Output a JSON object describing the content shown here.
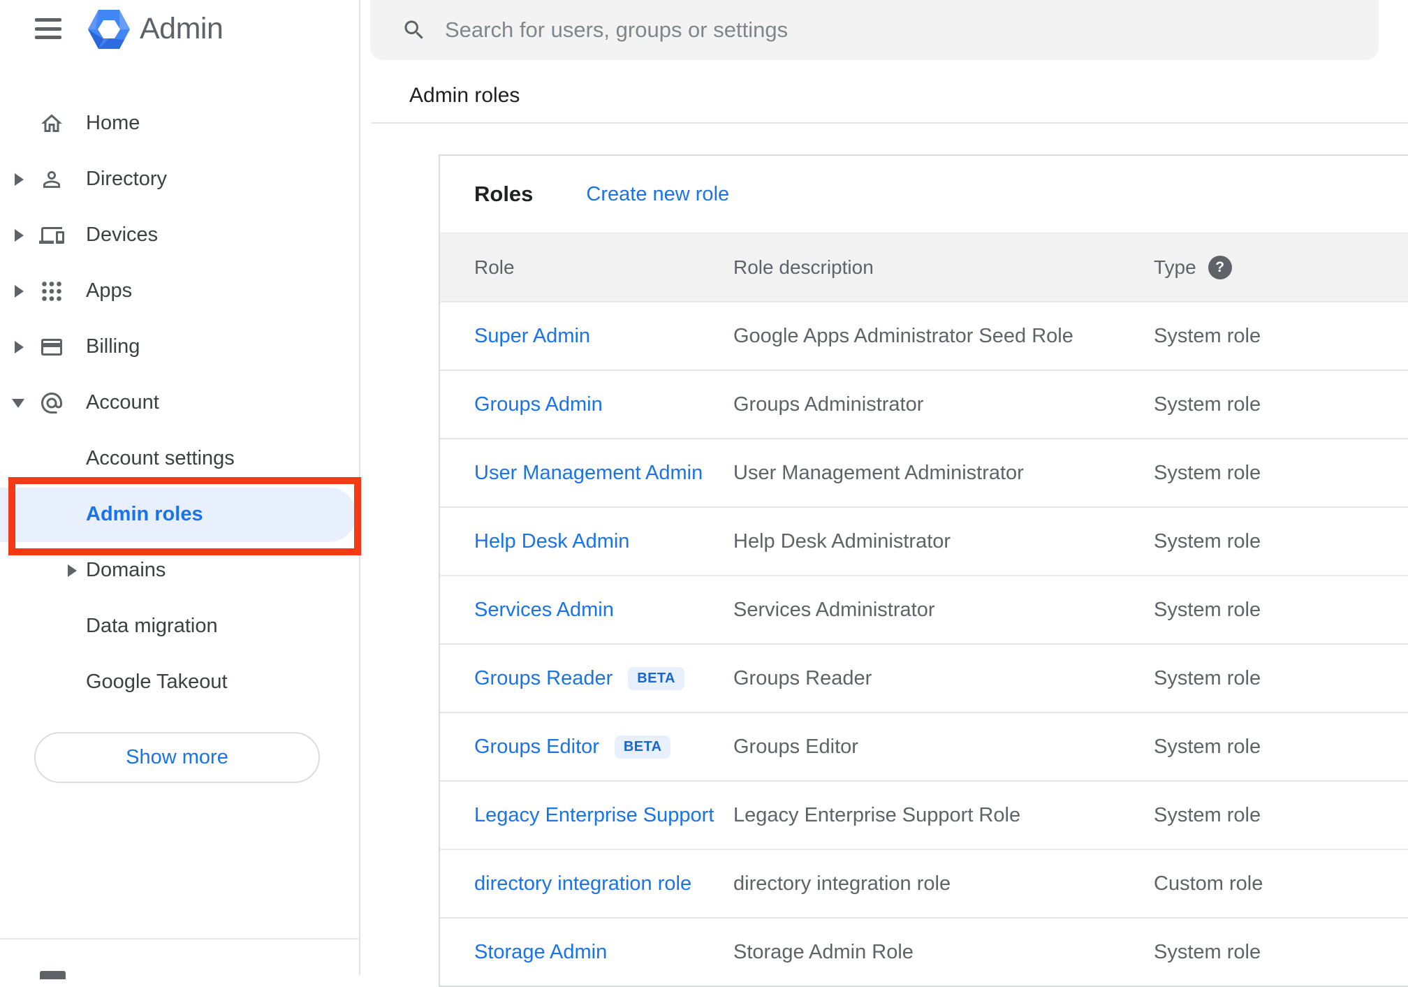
{
  "app": {
    "title": "Admin"
  },
  "topbar": {
    "search_placeholder": "Search for users, groups or settings"
  },
  "breadcrumb": {
    "label": "Admin roles"
  },
  "sidebar": {
    "items": [
      {
        "label": "Home",
        "icon": "home-icon",
        "expandable": false
      },
      {
        "label": "Directory",
        "icon": "person-icon",
        "expandable": true
      },
      {
        "label": "Devices",
        "icon": "devices-icon",
        "expandable": true
      },
      {
        "label": "Apps",
        "icon": "apps-grid-icon",
        "expandable": true
      },
      {
        "label": "Billing",
        "icon": "credit-card-icon",
        "expandable": true
      },
      {
        "label": "Account",
        "icon": "at-sign-icon",
        "expandable": true,
        "expanded": true
      }
    ],
    "account_subitems": [
      {
        "label": "Account settings",
        "active": false
      },
      {
        "label": "Admin roles",
        "active": true,
        "annotated": true
      },
      {
        "label": "Domains",
        "expandable": true
      },
      {
        "label": "Data migration"
      },
      {
        "label": "Google Takeout"
      }
    ],
    "show_more_label": "Show more"
  },
  "roles_card": {
    "title": "Roles",
    "create_new_role_label": "Create new role",
    "table": {
      "columns": {
        "role": "Role",
        "description": "Role description",
        "type": "Type"
      },
      "beta_badge_label": "BETA",
      "rows": [
        {
          "role": "Super Admin",
          "beta": false,
          "description": "Google Apps Administrator Seed Role",
          "type": "System role"
        },
        {
          "role": "Groups Admin",
          "beta": false,
          "description": "Groups Administrator",
          "type": "System role"
        },
        {
          "role": "User Management Admin",
          "beta": false,
          "description": "User Management Administrator",
          "type": "System role"
        },
        {
          "role": "Help Desk Admin",
          "beta": false,
          "description": "Help Desk Administrator",
          "type": "System role"
        },
        {
          "role": "Services Admin",
          "beta": false,
          "description": "Services Administrator",
          "type": "System role"
        },
        {
          "role": "Groups Reader",
          "beta": true,
          "description": "Groups Reader",
          "type": "System role"
        },
        {
          "role": "Groups Editor",
          "beta": true,
          "description": "Groups Editor",
          "type": "System role"
        },
        {
          "role": "Legacy Enterprise Support",
          "beta": false,
          "description": "Legacy Enterprise Support Role",
          "type": "System role"
        },
        {
          "role": "directory integration role",
          "beta": false,
          "description": "directory integration role",
          "type": "Custom role"
        },
        {
          "role": "Storage Admin",
          "beta": false,
          "description": "Storage Admin Role",
          "type": "System role"
        }
      ]
    }
  },
  "colors": {
    "accent_blue": "#1a73e8",
    "badge_bg": "#e8f0fe",
    "badge_text": "#1866d1",
    "active_item_bg": "#e8f0fe",
    "annotation_red": "#f23a17",
    "icon_gray": "#5f6368"
  }
}
